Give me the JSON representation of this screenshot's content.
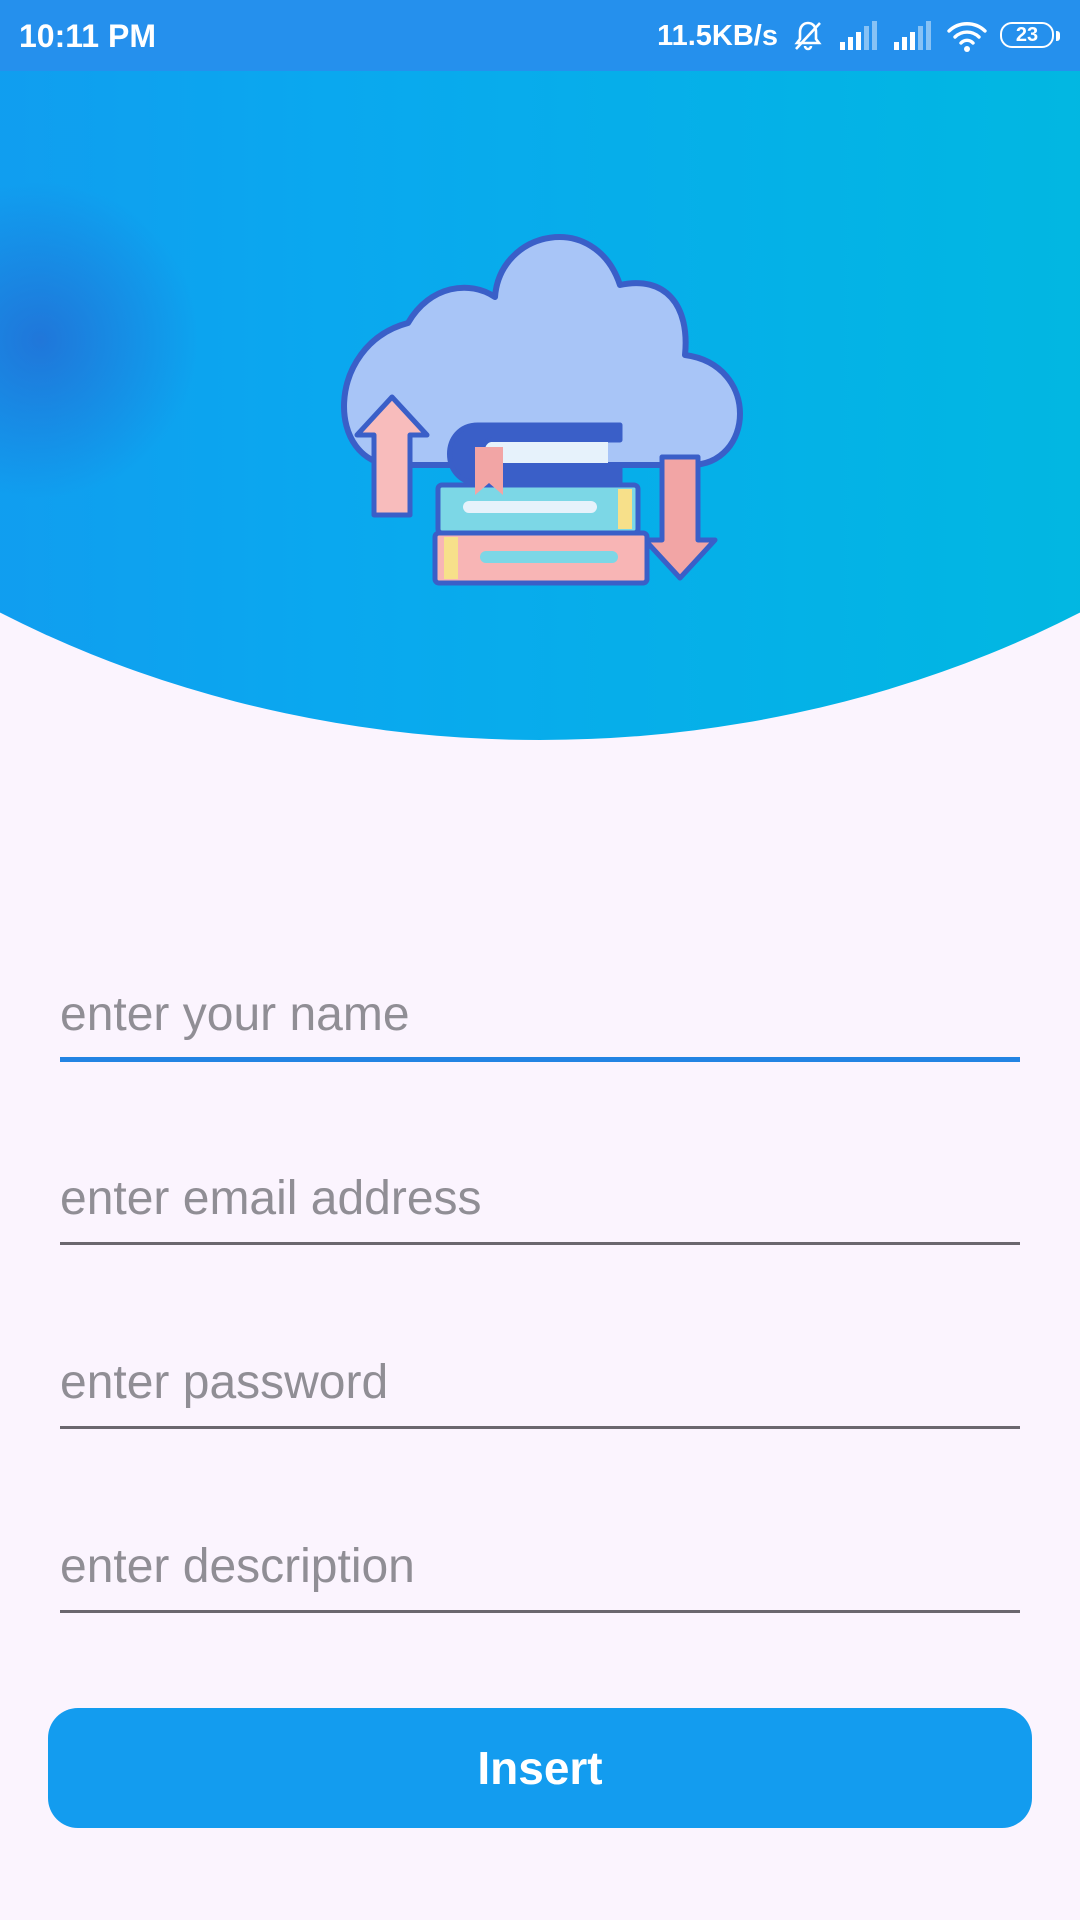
{
  "status_bar": {
    "time": "10:11 PM",
    "net_speed": "11.5KB/s",
    "battery": "23",
    "icons": [
      "mute-alarm-icon",
      "signal-icon",
      "signal-icon",
      "wifi-icon",
      "battery-icon"
    ]
  },
  "header": {
    "illustration": "cloud-books-sync-icon",
    "colors": {
      "gradient_start": "#1a8ef0",
      "gradient_end": "#00c0d6"
    }
  },
  "form": {
    "fields": [
      {
        "placeholder": "enter your name",
        "value": "",
        "focused": true
      },
      {
        "placeholder": "enter email address",
        "value": ""
      },
      {
        "placeholder": "enter password",
        "value": ""
      },
      {
        "placeholder": "enter description",
        "value": ""
      }
    ],
    "submit_label": "Insert",
    "accent": "#139cef",
    "focus_color": "#2384e3"
  }
}
